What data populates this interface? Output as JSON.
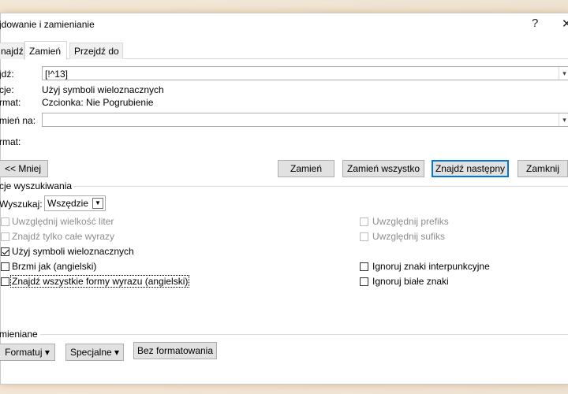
{
  "window": {
    "title": "jdowanie i zamienianie",
    "help": "?",
    "close": "✕"
  },
  "tabs": [
    {
      "label": "najdź"
    },
    {
      "label": "Zamień"
    },
    {
      "label": "Przejdź do"
    }
  ],
  "find": {
    "label": "jdź:",
    "value": "[!^13]"
  },
  "options_row": {
    "label": "cje:",
    "value": "Użyj symboli wieloznacznych"
  },
  "format_row": {
    "label": "rmat:",
    "value": "Czcionka: Nie Pogrubienie"
  },
  "replace": {
    "label": "mień na:",
    "value": ""
  },
  "replace_format": {
    "label": "rmat:"
  },
  "buttons": {
    "less": "<< Mniej",
    "replace": "Zamień",
    "replace_all": "Zamień wszystko",
    "find_next": "Znajdź następny",
    "close": "Zamknij"
  },
  "search_options": {
    "header": "cje wyszukiwania",
    "search_label": "Wyszukaj:",
    "search_value": "Wszędzie",
    "left": [
      {
        "label": "Uwzględnij wielkość liter",
        "checked": false,
        "disabled": true
      },
      {
        "label": "Znajdź tylko całe wyrazy",
        "checked": false,
        "disabled": true
      },
      {
        "label": "Użyj symboli wieloznacznych",
        "checked": true,
        "disabled": false
      },
      {
        "label": "Brzmi jak (angielski)",
        "checked": false,
        "disabled": false
      },
      {
        "label": "Znajdź wszystkie formy wyrazu (angielski)",
        "checked": false,
        "disabled": false
      }
    ],
    "right": [
      {
        "label": "Uwzględnij prefiks",
        "checked": false,
        "disabled": true
      },
      {
        "label": "Uwzględnij sufiks",
        "checked": false,
        "disabled": true
      },
      {
        "label": "Ignoruj znaki interpunkcyjne",
        "checked": false,
        "disabled": false
      },
      {
        "label": "Ignoruj białe znaki",
        "checked": false,
        "disabled": false
      }
    ]
  },
  "replacing": {
    "header": "mieniane",
    "format": "Formatuj ▾",
    "special": "Specjalne ▾",
    "no_format": "Bez formatowania"
  }
}
